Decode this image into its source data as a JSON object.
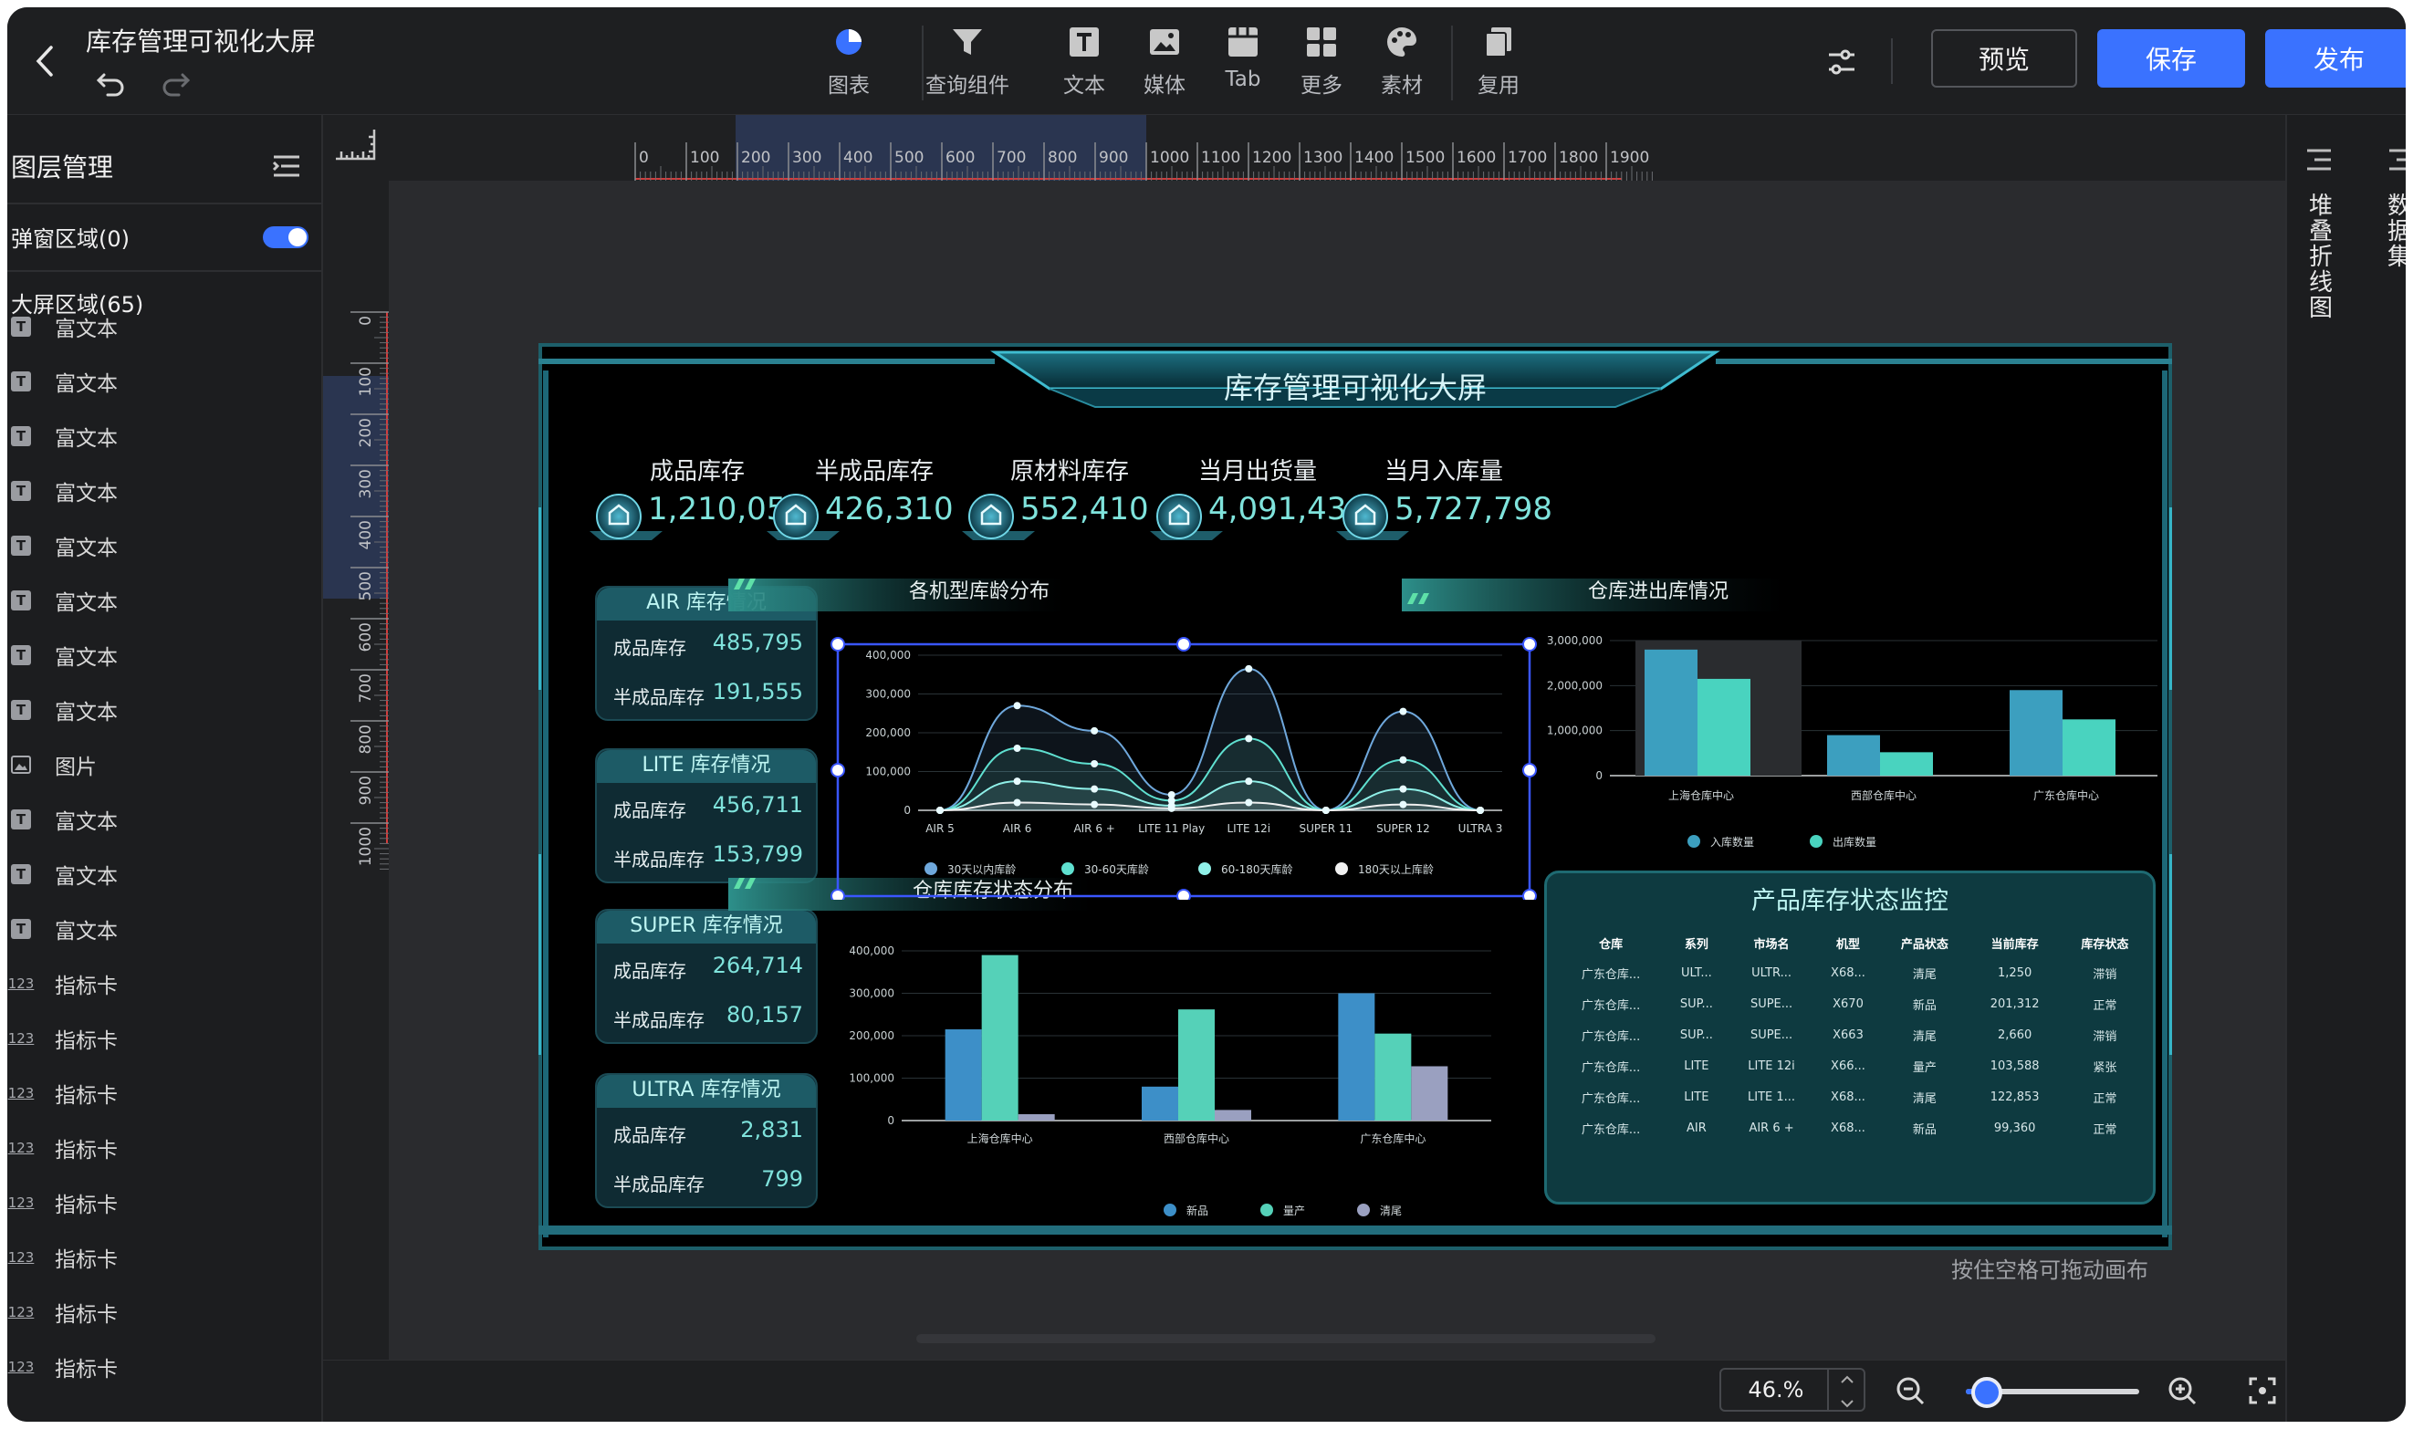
{
  "app": {
    "title": "库存管理可视化大屏"
  },
  "toolbar": {
    "tools": [
      {
        "label": "图表",
        "icon": "pie-chart-icon"
      },
      {
        "label": "查询组件",
        "icon": "filter-icon"
      },
      {
        "label": "文本",
        "icon": "text-icon"
      },
      {
        "label": "媒体",
        "icon": "image-icon"
      },
      {
        "label": "Tab",
        "icon": "tab-icon"
      },
      {
        "label": "更多",
        "icon": "grid-icon"
      },
      {
        "label": "素材",
        "icon": "palette-icon"
      },
      {
        "label": "复用",
        "icon": "copy-icon"
      }
    ],
    "preview_label": "预览",
    "save_label": "保存",
    "publish_label": "发布"
  },
  "layers": {
    "title": "图层管理",
    "popup_area": "弹窗区域(0)",
    "popup_toggle": true,
    "screen_area": "大屏区域(65)",
    "items": [
      {
        "label": "富文本",
        "type": "text"
      },
      {
        "label": "富文本",
        "type": "text"
      },
      {
        "label": "富文本",
        "type": "text"
      },
      {
        "label": "富文本",
        "type": "text"
      },
      {
        "label": "富文本",
        "type": "text"
      },
      {
        "label": "富文本",
        "type": "text"
      },
      {
        "label": "富文本",
        "type": "text"
      },
      {
        "label": "富文本",
        "type": "text"
      },
      {
        "label": "图片",
        "type": "image"
      },
      {
        "label": "富文本",
        "type": "text"
      },
      {
        "label": "富文本",
        "type": "text"
      },
      {
        "label": "富文本",
        "type": "text"
      },
      {
        "label": "指标卡",
        "type": "metric"
      },
      {
        "label": "指标卡",
        "type": "metric"
      },
      {
        "label": "指标卡",
        "type": "metric"
      },
      {
        "label": "指标卡",
        "type": "metric"
      },
      {
        "label": "指标卡",
        "type": "metric"
      },
      {
        "label": "指标卡",
        "type": "metric"
      },
      {
        "label": "指标卡",
        "type": "metric"
      },
      {
        "label": "指标卡",
        "type": "metric"
      }
    ]
  },
  "rulers": {
    "h_ticks": [
      "0",
      "100",
      "200",
      "300",
      "400",
      "500",
      "600",
      "700",
      "800",
      "900",
      "1000",
      "1100",
      "1200",
      "1300",
      "1400",
      "1500",
      "1600",
      "1700",
      "1800",
      "1900"
    ],
    "v_ticks": [
      "0",
      "100",
      "200",
      "300",
      "400",
      "500",
      "600",
      "700",
      "800",
      "900",
      "1000"
    ]
  },
  "canvas": {
    "hint": "按住空格可拖动画布"
  },
  "right_rail": {
    "tabs": [
      "堆叠折线图",
      "数据集"
    ]
  },
  "zoom": {
    "value": "46.%",
    "slider_fraction": 0.12
  },
  "dashboard": {
    "title": "库存管理可视化大屏",
    "kpis": [
      {
        "label": "成品库存",
        "value": "1,210,051"
      },
      {
        "label": "半成品库存",
        "value": "426,310"
      },
      {
        "label": "原材料库存",
        "value": "552,410"
      },
      {
        "label": "当月出货量",
        "value": "4,091,436"
      },
      {
        "label": "当月入库量",
        "value": "5,727,798"
      }
    ],
    "cards": [
      {
        "title": "AIR 库存情况",
        "row1_label": "成品库存",
        "row1_value": "485,795",
        "row2_label": "半成品库存",
        "row2_value": "191,555"
      },
      {
        "title": "LITE 库存情况",
        "row1_label": "成品库存",
        "row1_value": "456,711",
        "row2_label": "半成品库存",
        "row2_value": "153,799"
      },
      {
        "title": "SUPER 库存情况",
        "row1_label": "成品库存",
        "row1_value": "264,714",
        "row2_label": "半成品库存",
        "row2_value": "80,157"
      },
      {
        "title": "ULTRA 库存情况",
        "row1_label": "成品库存",
        "row1_value": "2,831",
        "row2_label": "半成品库存",
        "row2_value": "799"
      }
    ],
    "section_titles": {
      "age": "各机型库龄分布",
      "inout": "仓库进出库情况",
      "status": "仓库库存状态分布"
    },
    "monitor": {
      "title": "产品库存状态监控",
      "columns": [
        "仓库",
        "系列",
        "市场名",
        "机型",
        "产品状态",
        "当前库存",
        "库存状态"
      ],
      "rows": [
        [
          "广东仓库...",
          "ULT...",
          "ULTR...",
          "X68...",
          "清尾",
          "1,250",
          "滞销"
        ],
        [
          "广东仓库...",
          "SUP...",
          "SUPE...",
          "X670",
          "新品",
          "201,312",
          "正常"
        ],
        [
          "广东仓库...",
          "SUP...",
          "SUPE...",
          "X663",
          "清尾",
          "2,660",
          "滞销"
        ],
        [
          "广东仓库...",
          "LITE",
          "LITE 12i",
          "X66...",
          "量产",
          "103,588",
          "紧张"
        ],
        [
          "广东仓库...",
          "LITE",
          "LITE 1...",
          "X68...",
          "清尾",
          "122,853",
          "正常"
        ],
        [
          "广东仓库...",
          "AIR",
          "AIR 6 +",
          "X68...",
          "新品",
          "99,360",
          "正常"
        ]
      ]
    }
  },
  "chart_data": [
    {
      "type": "area",
      "title": "各机型库龄分布",
      "categories": [
        "AIR 5",
        "AIR 6",
        "AIR 6 +",
        "LITE 11 Play",
        "LITE 12i",
        "SUPER 11",
        "SUPER 12",
        "ULTRA 3"
      ],
      "ylim": [
        0,
        400000
      ],
      "yticks": [
        "0",
        "100,000",
        "200,000",
        "300,000",
        "400,000"
      ],
      "series": [
        {
          "name": "30天以内库龄",
          "color": "#6fa8dc",
          "values": [
            0,
            270000,
            205000,
            40000,
            365000,
            0,
            255000,
            0
          ]
        },
        {
          "name": "30-60天库龄",
          "color": "#5fe0d0",
          "values": [
            0,
            160000,
            120000,
            25000,
            185000,
            0,
            130000,
            0
          ]
        },
        {
          "name": "60-180天库龄",
          "color": "#8ff0e8",
          "values": [
            0,
            75000,
            55000,
            12000,
            75000,
            0,
            55000,
            0
          ]
        },
        {
          "name": "180天以上库龄",
          "color": "#f0f0f0",
          "values": [
            0,
            20000,
            15000,
            5000,
            20000,
            0,
            15000,
            0
          ]
        }
      ]
    },
    {
      "type": "bar",
      "title": "仓库进出库情况",
      "categories": [
        "上海仓库中心",
        "西部仓库中心",
        "广东仓库中心"
      ],
      "ylim": [
        0,
        3000000
      ],
      "yticks": [
        "0",
        "1,000,000",
        "2,000,000",
        "3,000,000"
      ],
      "series": [
        {
          "name": "入库数量",
          "color": "#3c9fbf",
          "values": [
            2800000,
            900000,
            1900000
          ]
        },
        {
          "name": "出库数量",
          "color": "#49d3bf",
          "values": [
            2150000,
            520000,
            1250000
          ]
        }
      ]
    },
    {
      "type": "bar",
      "title": "仓库库存状态分布",
      "categories": [
        "上海仓库中心",
        "西部仓库中心",
        "广东仓库中心"
      ],
      "ylim": [
        0,
        400000
      ],
      "yticks": [
        "0",
        "100,000",
        "200,000",
        "300,000",
        "400,000"
      ],
      "series": [
        {
          "name": "新品",
          "color": "#3d8fc8",
          "values": [
            215000,
            80000,
            300000
          ]
        },
        {
          "name": "量产",
          "color": "#55d1b8",
          "values": [
            390000,
            262000,
            205000
          ]
        },
        {
          "name": "清尾",
          "color": "#9aa0c0",
          "values": [
            15000,
            25000,
            128000
          ]
        }
      ]
    }
  ]
}
